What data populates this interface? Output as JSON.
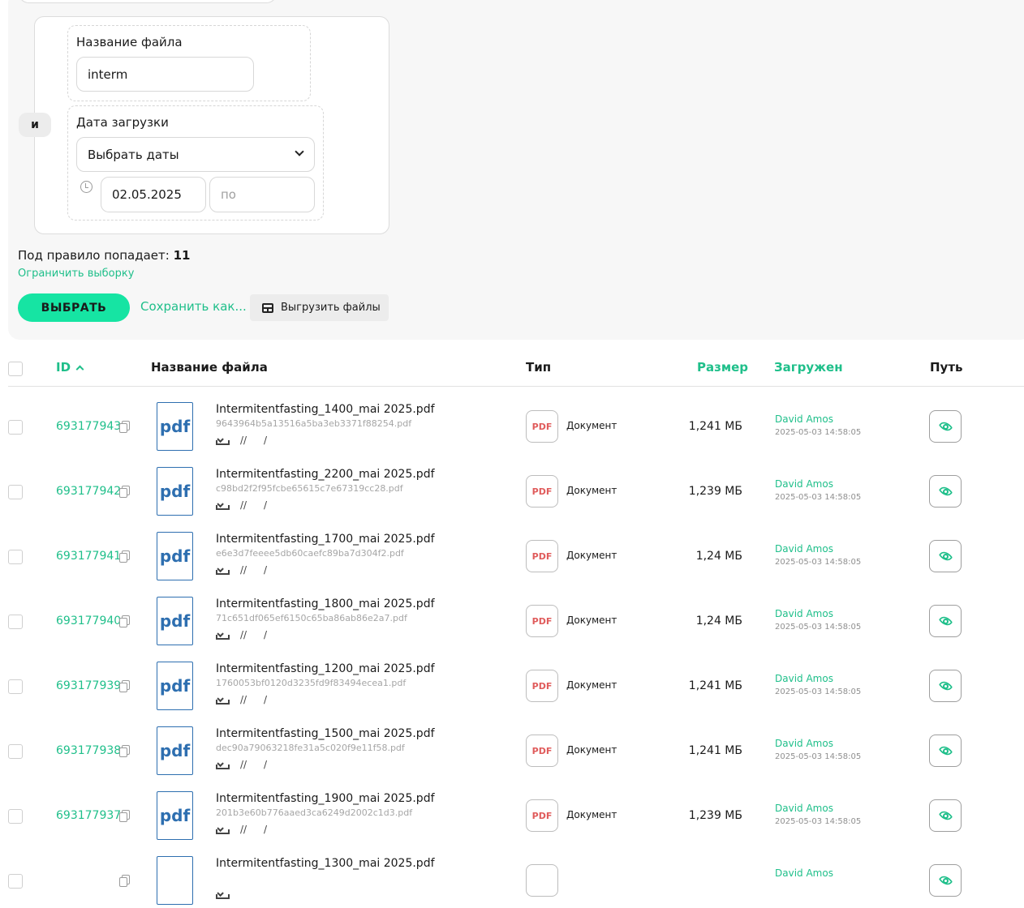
{
  "filter": {
    "joiner": "и",
    "file_name_label": "Название файла",
    "file_name_value": "interm",
    "upload_date_label": "Дата загрузки",
    "date_mode_select": "Выбрать даты",
    "date_from": "02.05.2025",
    "date_to_placeholder": "по"
  },
  "summary": {
    "rule_count_label": "Под правило попадает:",
    "rule_count": "11",
    "limit_link": "Ограничить выборку"
  },
  "actions": {
    "select_button": "ВЫБРАТЬ",
    "save_as": "Сохранить как...",
    "export_button": "Выгрузить файлы"
  },
  "table": {
    "headers": {
      "id": "ID",
      "name": "Название файла",
      "type": "Тип",
      "size": "Размер",
      "uploaded": "Загружен",
      "path": "Путь"
    },
    "rows": [
      {
        "id": "693177943",
        "thumb": "pdf",
        "name": "Intermitentfasting_1400_mai 2025.pdf",
        "hash": "9643964b5a13516a5ba3eb3371f88254.pdf",
        "sep1": "//",
        "sep2": "/",
        "type_badge": "PDF",
        "type": "Документ",
        "size": "1,241 МБ",
        "uploader": "David Amos",
        "date": "2025-05-03 14:58:05"
      },
      {
        "id": "693177942",
        "thumb": "pdf",
        "name": "Intermitentfasting_2200_mai 2025.pdf",
        "hash": "c98bd2f2f95fcbe65615c7e67319cc28.pdf",
        "sep1": "//",
        "sep2": "/",
        "type_badge": "PDF",
        "type": "Документ",
        "size": "1,239 МБ",
        "uploader": "David Amos",
        "date": "2025-05-03 14:58:05"
      },
      {
        "id": "693177941",
        "thumb": "pdf",
        "name": "Intermitentfasting_1700_mai 2025.pdf",
        "hash": "e6e3d7feeee5db60caefc89ba7d304f2.pdf",
        "sep1": "//",
        "sep2": "/",
        "type_badge": "PDF",
        "type": "Документ",
        "size": "1,24 МБ",
        "uploader": "David Amos",
        "date": "2025-05-03 14:58:05"
      },
      {
        "id": "693177940",
        "thumb": "pdf",
        "name": "Intermitentfasting_1800_mai 2025.pdf",
        "hash": "71c651df065ef6150c65ba86ab86e2a7.pdf",
        "sep1": "//",
        "sep2": "/",
        "type_badge": "PDF",
        "type": "Документ",
        "size": "1,24 МБ",
        "uploader": "David Amos",
        "date": "2025-05-03 14:58:05"
      },
      {
        "id": "693177939",
        "thumb": "pdf",
        "name": "Intermitentfasting_1200_mai 2025.pdf",
        "hash": "1760053bf0120d3235fd9f83494ecea1.pdf",
        "sep1": "//",
        "sep2": "/",
        "type_badge": "PDF",
        "type": "Документ",
        "size": "1,241 МБ",
        "uploader": "David Amos",
        "date": "2025-05-03 14:58:05"
      },
      {
        "id": "693177938",
        "thumb": "pdf",
        "name": "Intermitentfasting_1500_mai 2025.pdf",
        "hash": "dec90a79063218fe31a5c020f9e11f58.pdf",
        "sep1": "//",
        "sep2": "/",
        "type_badge": "PDF",
        "type": "Документ",
        "size": "1,241 МБ",
        "uploader": "David Amos",
        "date": "2025-05-03 14:58:05"
      },
      {
        "id": "693177937",
        "thumb": "pdf",
        "name": "Intermitentfasting_1900_mai 2025.pdf",
        "hash": "201b3e60b776aaed3ca6249d2002c1d3.pdf",
        "sep1": "//",
        "sep2": "/",
        "type_badge": "PDF",
        "type": "Документ",
        "size": "1,239 МБ",
        "uploader": "David Amos",
        "date": "2025-05-03 14:58:05"
      },
      {
        "id": "",
        "thumb": "",
        "name": "Intermitentfasting_1300_mai 2025.pdf",
        "hash": "",
        "sep1": "",
        "sep2": "",
        "type_badge": "",
        "type": "",
        "size": "",
        "uploader": "David Amos",
        "date": ""
      }
    ]
  },
  "colors": {
    "accent": "#1fbf8a",
    "button": "#16e4a3",
    "pdf_thumb": "#2e6fb0",
    "pdf_badge": "#e05c5c"
  }
}
